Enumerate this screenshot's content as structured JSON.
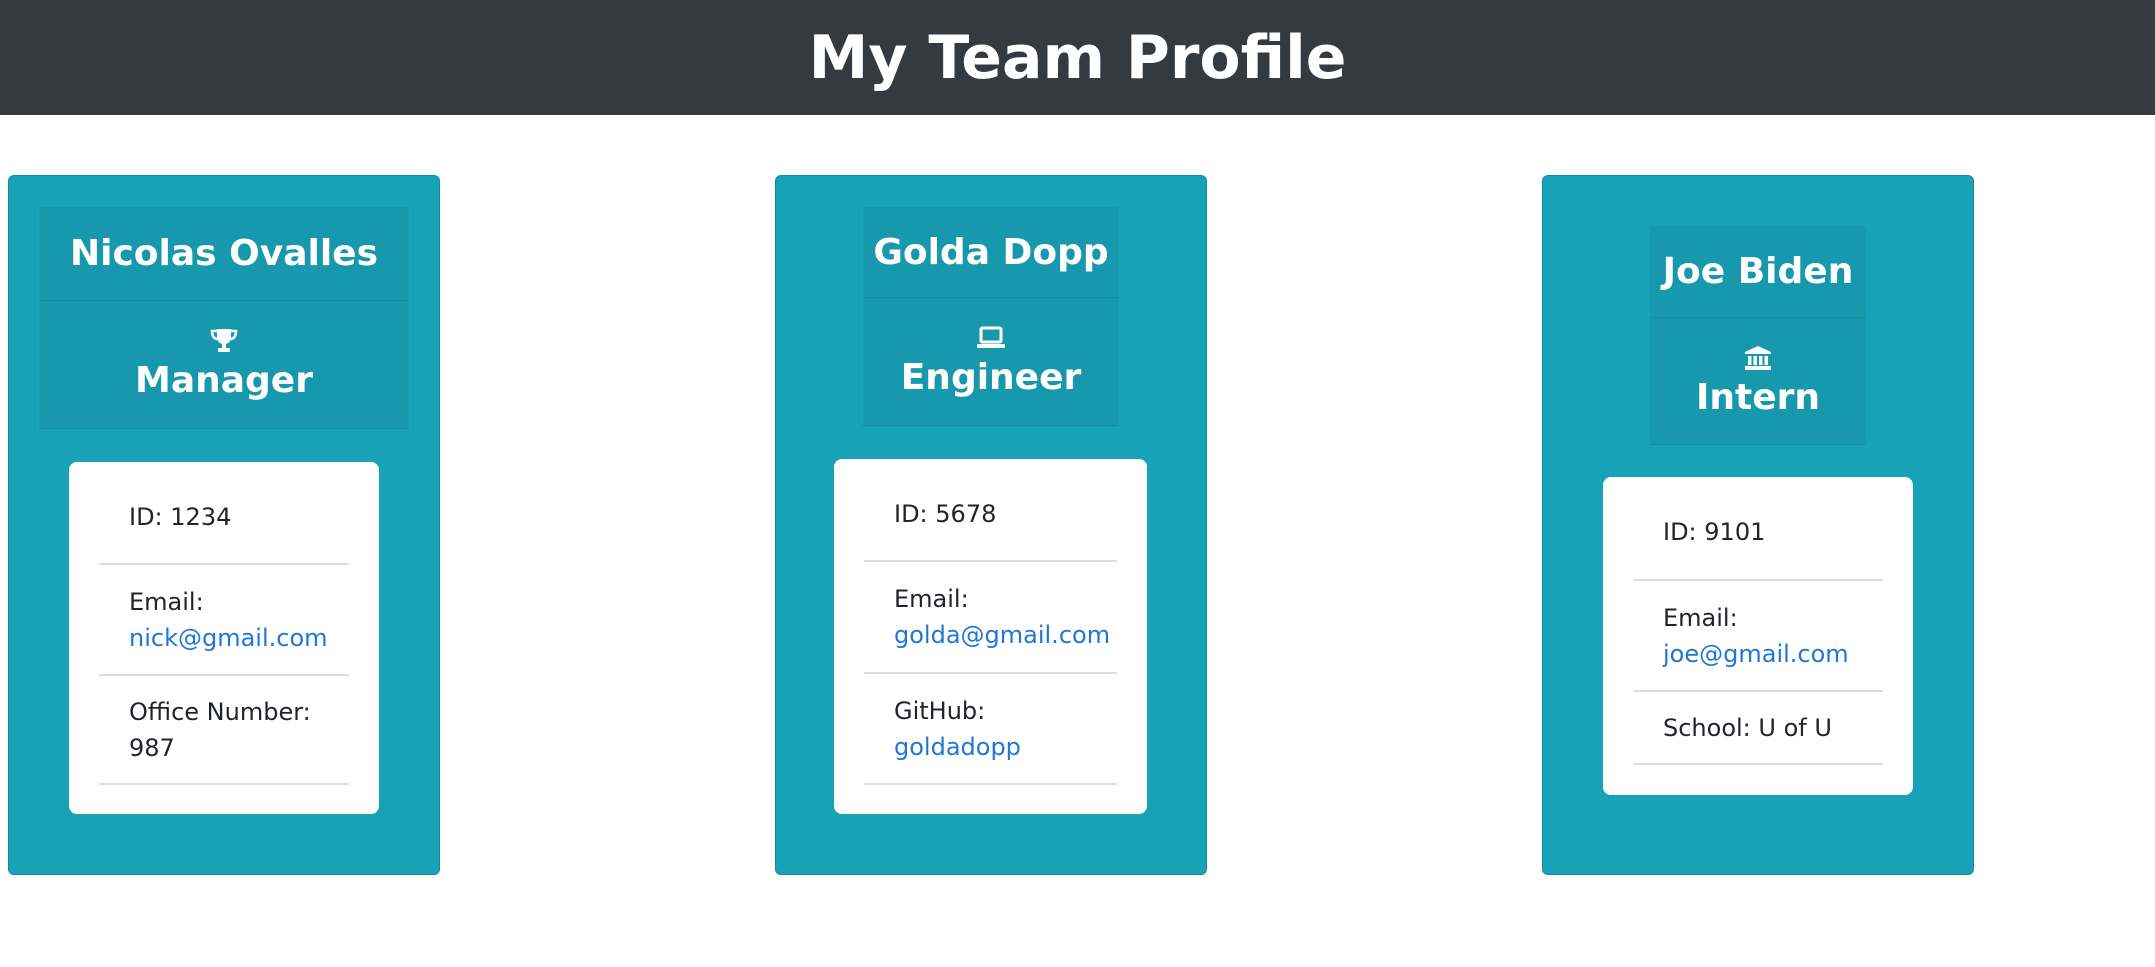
{
  "header": {
    "title": "My Team Profile"
  },
  "cards": [
    {
      "name": "Nicolas Ovalles",
      "role": "Manager",
      "role_icon": "trophy-icon",
      "id_text": "ID: 1234",
      "email_label": "Email:",
      "email": "nick@gmail.com",
      "extra_label": "Office Number:",
      "extra_value": "987"
    },
    {
      "name": "Golda Dopp",
      "role": "Engineer",
      "role_icon": "laptop-icon",
      "id_text": "ID: 5678",
      "email_label": "Email:",
      "email": "golda@gmail.com",
      "extra_label": "GitHub:",
      "extra_value": "goldadopp"
    },
    {
      "name": "Joe Biden",
      "role": "Intern",
      "role_icon": "university-icon",
      "id_text": "ID: 9101",
      "email_label": "Email:",
      "email": "joe@gmail.com",
      "extra_text": "School: U of U"
    }
  ],
  "colors": {
    "header_bg": "#343a40",
    "card_bg": "#17a2b8",
    "link": "#2177d6"
  }
}
